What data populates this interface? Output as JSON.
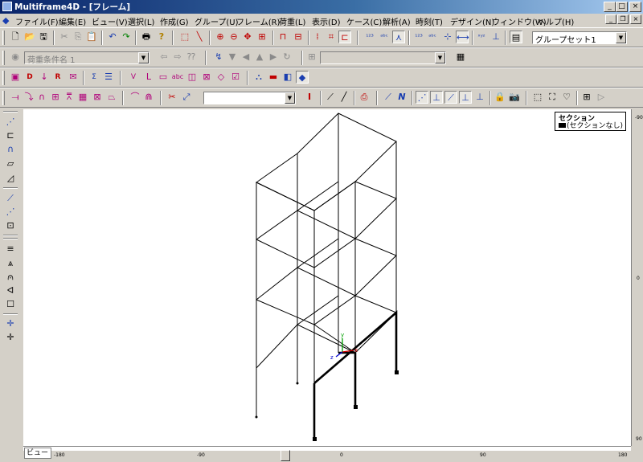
{
  "window": {
    "title": "Multiframe4D - [フレーム]",
    "minimize_glyph": "_",
    "maximize_glyph": "□",
    "close_glyph": "×",
    "mdi_restore_glyph": "❐"
  },
  "menu": [
    "ファイル(F)",
    "編集(E)",
    "ビュー(V)",
    "選択(L)",
    "作成(G)",
    "グループ(U)",
    "フレーム(R)",
    "荷重(L)",
    "表示(D)",
    "ケース(C)",
    "解析(A)",
    "時刻(T)",
    "デザイン(N)",
    "ウィンドウ(W)",
    "ヘルプ(H)"
  ],
  "toolbar": {
    "group_set": "グループセット1",
    "load_case": "荷重条件名 1",
    "table_combo": "",
    "member_combo": ""
  },
  "legend": {
    "title": "セクション",
    "item": "(セクションなし)"
  },
  "view_tab": "ビュー",
  "ruler": {
    "horizontal": [
      "-180",
      "-90",
      "0",
      "90",
      "180"
    ],
    "vertical": [
      "-90",
      "0",
      "90"
    ]
  },
  "axes": {
    "x": "x",
    "y": "y",
    "z": "z"
  },
  "icons": {
    "new": "new-file-icon",
    "open": "open-folder-icon",
    "save": "save-icon",
    "cut": "cut-icon",
    "copy": "copy-icon",
    "paste": "paste-icon",
    "undo": "undo-icon",
    "redo": "redo-icon",
    "print": "print-icon",
    "help": "help-icon"
  }
}
